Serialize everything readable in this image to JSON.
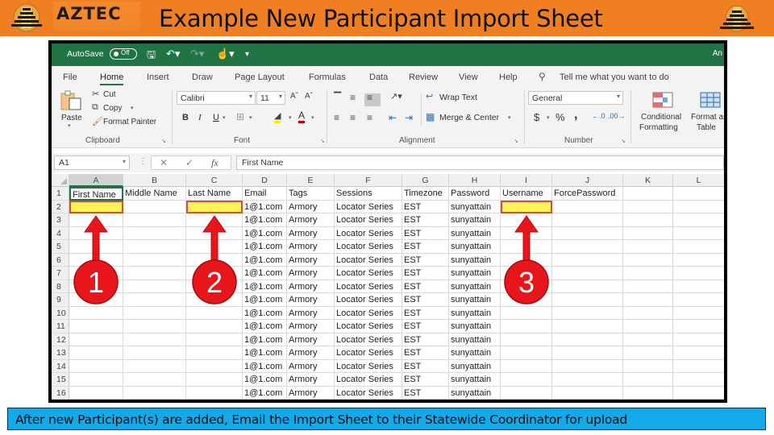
{
  "header": {
    "brand": "AZTEC",
    "title": "Example New Participant Import Sheet",
    "logo_left": "pyramid-logo-icon",
    "logo_right": "pyramid-logo-icon",
    "band_color": "#f07f22"
  },
  "excel": {
    "titlebar": {
      "autosave_label": "AutoSave",
      "autosave_state": "Off",
      "user_initials": "An",
      "accent": "#217346"
    },
    "tabs": [
      "File",
      "Home",
      "Insert",
      "Draw",
      "Page Layout",
      "Formulas",
      "Data",
      "Review",
      "View",
      "Help"
    ],
    "active_tab": "Home",
    "tell_me": "Tell me what you want to do",
    "ribbon": {
      "clipboard": {
        "label": "Clipboard",
        "paste": "Paste",
        "cut": "Cut",
        "copy": "Copy",
        "format_painter": "Format Painter"
      },
      "font": {
        "label": "Font",
        "font_name": "Calibri",
        "font_size": "11",
        "bold": "B",
        "italic": "I",
        "underline": "U",
        "font_color_letter": "A"
      },
      "alignment": {
        "label": "Alignment",
        "wrap_text": "Wrap Text",
        "merge_center": "Merge & Center"
      },
      "number": {
        "label": "Number",
        "format": "General",
        "currency": "$",
        "percent": "%",
        "comma": ","
      },
      "styles": {
        "conditional_formatting_1": "Conditional",
        "conditional_formatting_2": "Formatting",
        "format_table_1": "Format as",
        "format_table_2": "Table"
      }
    },
    "formula_bar": {
      "name_box": "A1",
      "fx": "fx",
      "content": "First Name"
    },
    "columns": [
      "A",
      "B",
      "C",
      "D",
      "E",
      "F",
      "G",
      "H",
      "I",
      "J",
      "K",
      "L"
    ],
    "headers": [
      "First Name",
      "Middle Name",
      "Last Name",
      "Email",
      "Tags",
      "Sessions",
      "Timezone",
      "Password",
      "Username",
      "ForcePassword",
      "",
      ""
    ],
    "row_numbers": [
      "1",
      "2",
      "3",
      "4",
      "5",
      "6",
      "7",
      "8",
      "9",
      "10",
      "11",
      "12",
      "13",
      "14",
      "15",
      "16"
    ],
    "row_template": {
      "email": "1@1.com",
      "tags": "Armory",
      "sessions": "Locator Series",
      "timezone": "EST",
      "password": "sunyattain"
    },
    "highlighted_columns": [
      "A",
      "C",
      "I"
    ]
  },
  "callouts": [
    {
      "number": "1",
      "target_column": "A"
    },
    {
      "number": "2",
      "target_column": "C"
    },
    {
      "number": "3",
      "target_column": "I"
    }
  ],
  "footer": {
    "text": "After new Participant(s) are added, Email the Import Sheet to their Statewide Coordinator for upload",
    "color": "#12aaea"
  }
}
